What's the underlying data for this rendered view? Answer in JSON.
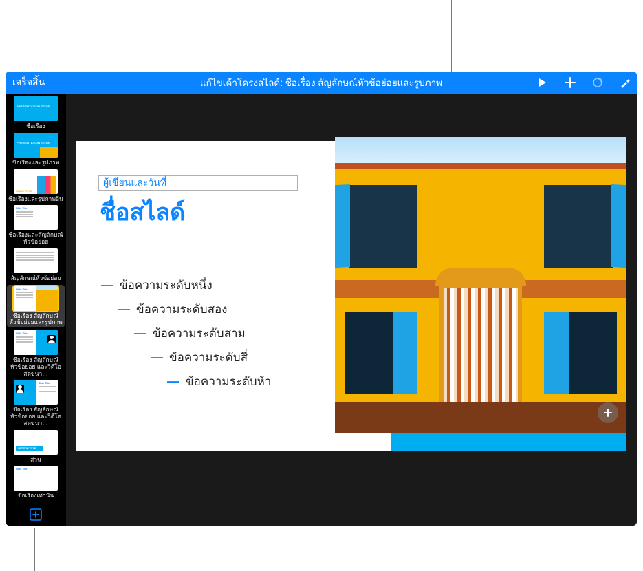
{
  "toolbar": {
    "done_label": "เสร็จสิ้น",
    "title_prefix": "แก้ไขเค้าโครงสไลด์: ",
    "title_layout_name": "ชื่อเรื่อง สัญลักษณ์หัวข้อย่อยและรูปภาพ"
  },
  "sidebar": {
    "items": [
      {
        "label": "ชื่อเรื่อง",
        "type": "title"
      },
      {
        "label": "ชื่อเรื่องและรูปภาพ",
        "type": "title-photo"
      },
      {
        "label": "ชื่อเรื่องและรูปภาพอื่น",
        "type": "title-photo-alt"
      },
      {
        "label": "ชื่อเรื่องและสัญลักษณ์หัวข้อย่อย",
        "type": "title-bullets"
      },
      {
        "label": "สัญลักษณ์หัวข้อย่อย",
        "type": "bullets"
      },
      {
        "label": "ชื่อเรื่อง สัญลักษณ์หัวข้อย่อยและรูปภาพ",
        "type": "title-bullets-photo",
        "selected": true
      },
      {
        "label": "ชื่อเรื่อง สัญลักษณ์หัวข้อย่อย และวิดีโอสดขนา…",
        "type": "title-bullets-live-r"
      },
      {
        "label": "ชื่อเรื่อง สัญลักษณ์หัวข้อย่อย และวิดีโอสดขนา…",
        "type": "title-bullets-live-l"
      },
      {
        "label": "ส่วน",
        "type": "section"
      },
      {
        "label": "ชื่อเรื่องเท่านั้น",
        "type": "title-only"
      }
    ]
  },
  "slide": {
    "author_placeholder": "ผู้เขียนและวันที่",
    "title_placeholder": "ชื่อสไลด์",
    "bullets": [
      "ข้อความระดับหนึ่ง",
      "ข้อความระดับสอง",
      "ข้อความระดับสาม",
      "ข้อความระดับสี่",
      "ข้อความระดับห้า"
    ]
  },
  "colors": {
    "toolbar_bg": "#0a84ff",
    "slide_bg": "#00aeef",
    "accent_text": "#0a84ff"
  }
}
